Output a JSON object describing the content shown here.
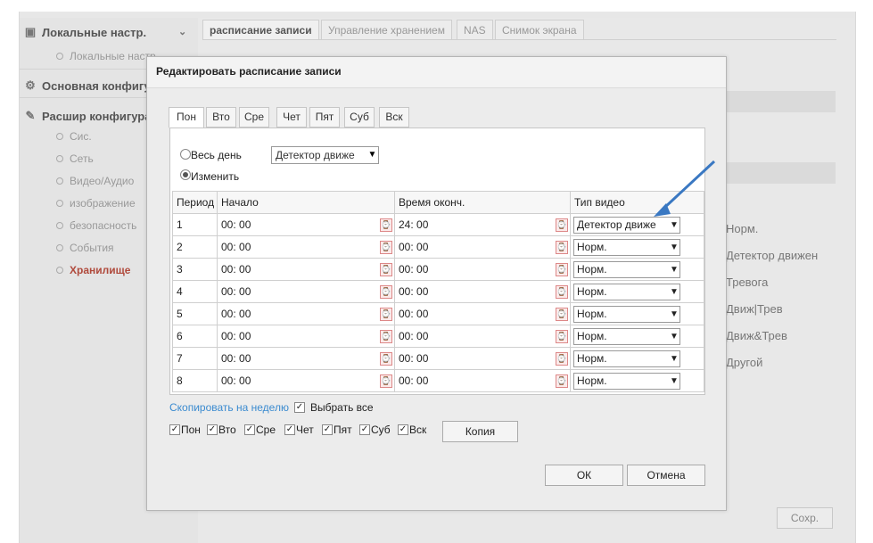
{
  "sidebar": {
    "local_settings": "Локальные настр.",
    "local_settings_sub": "Локальные настр",
    "basic_config": "Основная конфигу",
    "advanced_config": "Расшир конфигура",
    "items": [
      "Сис.",
      "Сеть",
      "Видео/Аудио",
      "изображение",
      "безопасность",
      "События",
      "Хранилище"
    ]
  },
  "top_tabs": [
    "расписание записи",
    "Управление хранением",
    "NAS",
    "Снимок экрана"
  ],
  "background_video_types": [
    "Норм.",
    "Детектор движен",
    "Тревога",
    "Движ|Трев",
    "Движ&Трев",
    "Другой"
  ],
  "save_label": "Сохр.",
  "modal": {
    "title": "Редактировать расписание записи",
    "day_tabs": [
      "Пон",
      "Вто",
      "Сре",
      "Чет",
      "Пят",
      "Суб",
      "Вск"
    ],
    "all_day_label": "Весь день",
    "all_day_select": "Детектор движе",
    "customize_label": "Изменить",
    "columns": [
      "Период",
      "Начало",
      "Время оконч.",
      "Тип видео"
    ],
    "rows": [
      {
        "period": "1",
        "start": "00: 00",
        "end": "24: 00",
        "type": "Детектор движе"
      },
      {
        "period": "2",
        "start": "00: 00",
        "end": "00: 00",
        "type": "Норм."
      },
      {
        "period": "3",
        "start": "00: 00",
        "end": "00: 00",
        "type": "Норм."
      },
      {
        "period": "4",
        "start": "00: 00",
        "end": "00: 00",
        "type": "Норм."
      },
      {
        "period": "5",
        "start": "00: 00",
        "end": "00: 00",
        "type": "Норм."
      },
      {
        "period": "6",
        "start": "00: 00",
        "end": "00: 00",
        "type": "Норм."
      },
      {
        "period": "7",
        "start": "00: 00",
        "end": "00: 00",
        "type": "Норм."
      },
      {
        "period": "8",
        "start": "00: 00",
        "end": "00: 00",
        "type": "Норм."
      }
    ],
    "copy_to_week": "Скопировать на неделю",
    "select_all": "Выбрать все",
    "copy_days": [
      "Пон",
      "Вто",
      "Сре",
      "Чет",
      "Пят",
      "Суб",
      "Вск"
    ],
    "copy_button": "Копия",
    "ok_button": "ОК",
    "cancel_button": "Отмена"
  },
  "colors": {
    "arrow": "#3a78c2",
    "active_nav": "#b04a3c",
    "link": "#3b8bd0"
  }
}
